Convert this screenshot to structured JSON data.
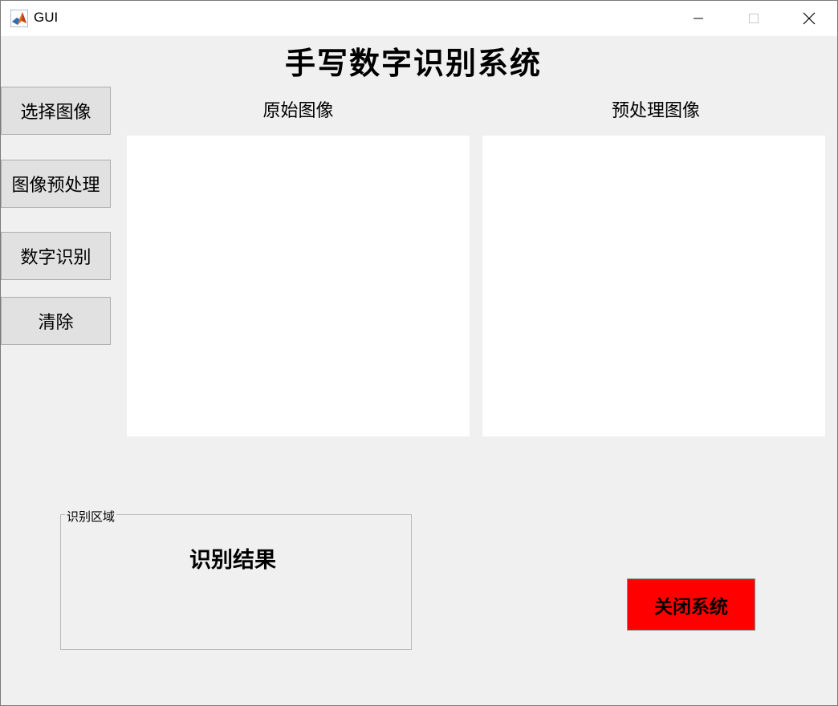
{
  "window": {
    "title": "GUI",
    "app_icon": "matlab-icon",
    "controls": [
      "minimize-icon",
      "maximize-icon",
      "close-icon"
    ]
  },
  "main_title": "手写数字识别系统",
  "sidebar": {
    "buttons": [
      {
        "label": "选择图像"
      },
      {
        "label": "图像预处理"
      },
      {
        "label": "数字识别"
      },
      {
        "label": "清除"
      }
    ]
  },
  "panels": {
    "original": {
      "label": "原始图像"
    },
    "preprocessed": {
      "label": "预处理图像"
    }
  },
  "recognition": {
    "group_label": "识别区域",
    "result_text": "识别结果"
  },
  "close_button": {
    "label": "关闭系统",
    "color": "#ff0000"
  }
}
